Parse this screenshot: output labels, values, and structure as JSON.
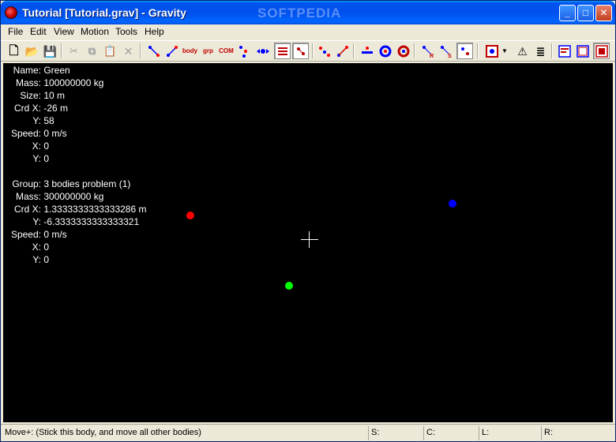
{
  "window": {
    "title": "Tutorial [Tutorial.grav] - Gravity",
    "watermark": "SOFTPEDIA",
    "minimize_label": "_",
    "maximize_label": "□",
    "close_label": "✕"
  },
  "menu": [
    "File",
    "Edit",
    "View",
    "Motion",
    "Tools",
    "Help"
  ],
  "toolbar": {
    "new": "🗋",
    "open": "📂",
    "save": "💾",
    "cut": "✂",
    "copy": "⧉",
    "paste": "📋",
    "delete": "✕",
    "body_label": "body",
    "com_label": "COM",
    "grp_label": "grp",
    "warning": "⚠",
    "list": "≣"
  },
  "selected_body": {
    "name_label": "Name:",
    "name": "Green",
    "mass_label": "Mass:",
    "mass": "100000000 kg",
    "size_label": "Size:",
    "size": "10 m",
    "crd_x_label": "Crd X:",
    "crd_x": "-26 m",
    "crd_y_label": "Y:",
    "crd_y": "58",
    "speed_label": "Speed:",
    "speed": "0 m/s",
    "speed_x_label": "X:",
    "speed_x": "0",
    "speed_y_label": "Y:",
    "speed_y": "0"
  },
  "group": {
    "group_label": "Group:",
    "group": "3 bodies problem (1)",
    "mass_label": "Mass:",
    "mass": "300000000 kg",
    "crd_x_label": "Crd X:",
    "crd_x": "1.3333333333333286 m",
    "crd_y_label": "Y:",
    "crd_y": "-6.3333333333333321",
    "speed_label": "Speed:",
    "speed": "0 m/s",
    "speed_x_label": "X:",
    "speed_x": "0",
    "speed_y_label": "Y:",
    "speed_y": "0"
  },
  "bodies_colors": {
    "red": "#ff0000",
    "blue": "#0000ff",
    "green": "#00ff00"
  },
  "status": {
    "message": "Move+: (Stick this body, and move all other bodies)",
    "s": "S:",
    "c": "C:",
    "l": "L:",
    "r": "R:"
  }
}
